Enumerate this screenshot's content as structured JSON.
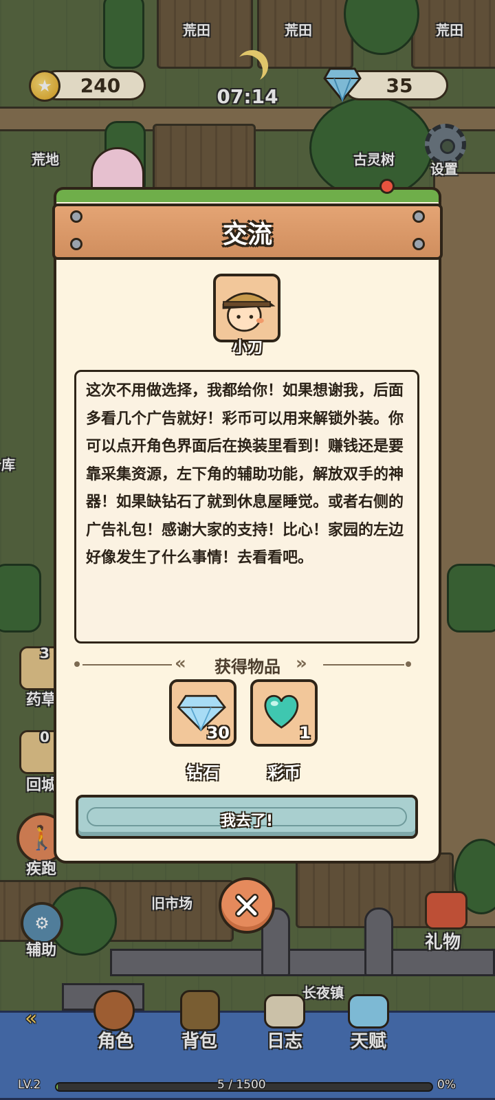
{
  "hud": {
    "coins": "240",
    "time": "07:14",
    "gems": "35",
    "settings_label": "设置"
  },
  "world_labels": {
    "field1": "荒田",
    "field2": "荒田",
    "field3": "荒田",
    "wasteland": "荒地",
    "ancient_tree": "古灵树",
    "warehouse": "仓库",
    "old_market": "旧市场",
    "long_night_town": "长夜镇"
  },
  "side_buttons": {
    "herb_count": "3",
    "herb_label": "药草",
    "recycle_count": "0",
    "recycle_label": "回城",
    "sprint_label": "疾跑",
    "assist_label": "辅助",
    "gift_label": "礼物"
  },
  "bottom_nav": {
    "character": "角色",
    "backpack": "背包",
    "journal": "日志",
    "talent": "天赋"
  },
  "status": {
    "level": "LV.2",
    "exp": "5 / 1500",
    "percent": "0%",
    "progress": 0.0033
  },
  "modal": {
    "title": "交流",
    "npc_name": "小刀",
    "dialog": "这次不用做选择，我都给你！如果想谢我，后面多看几个广告就好！彩币可以用来解锁外装。你可以点开角色界面后在换装里看到！赚钱还是要靠采集资源，左下角的辅助功能，解放双手的神器！如果缺钻石了就到休息屋睡觉。或者右侧的广告礼包！感谢大家的支持！比心！家园的左边好像发生了什么事情！去看看吧。",
    "rewards_title": "获得物品",
    "rewards": [
      {
        "name": "钻石",
        "qty": "30",
        "icon": "diamond-icon"
      },
      {
        "name": "彩币",
        "qty": "1",
        "icon": "heart-gem-icon"
      }
    ],
    "confirm_label": "我去了!"
  },
  "colors": {
    "plank": "#d08e5e",
    "panel": "#fdf4e0",
    "button": "#a9cfcf",
    "close": "#e58a5c"
  }
}
